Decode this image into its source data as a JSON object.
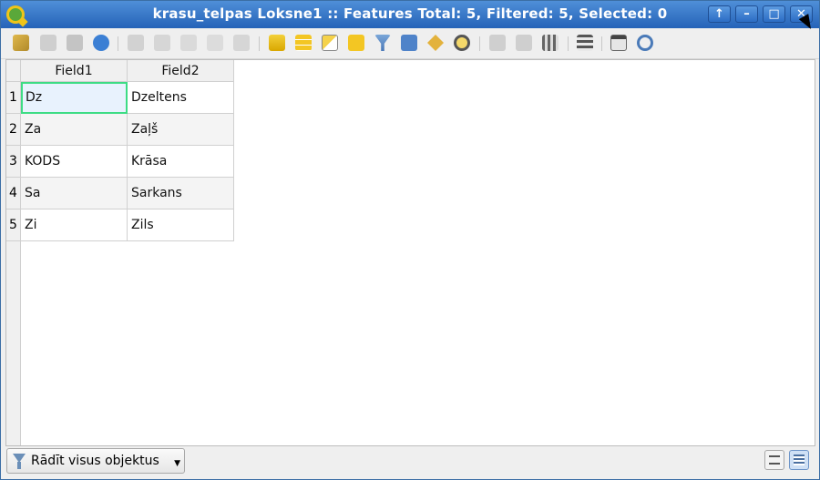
{
  "window": {
    "title": "krasu_telpas Loksne1 :: Features Total: 5, Filtered: 5, Selected: 0",
    "buttons": [
      "up-arrow-icon",
      "minimize-icon",
      "maximize-icon",
      "close-icon"
    ]
  },
  "toolbar": {
    "icons": [
      "toggle-editing-icon",
      "toggle-multi-edit-icon",
      "save-edits-icon",
      "reload-icon",
      "add-feature-icon",
      "delete-feature-icon",
      "cut-icon",
      "copy-icon",
      "paste-icon",
      "select-by-expression-icon",
      "select-all-icon",
      "invert-selection-icon",
      "deselect-all-icon",
      "filter-select-icon",
      "move-selection-to-top-icon",
      "pan-to-selected-icon",
      "zoom-to-selected-icon",
      "new-field-icon",
      "delete-field-icon",
      "field-calculator-icon",
      "conditional-formatting-icon",
      "dock-icon",
      "actions-icon"
    ]
  },
  "table": {
    "columns": [
      "Field1",
      "Field2"
    ],
    "rows": [
      {
        "num": "1",
        "field1": "Dz",
        "field2": "Dzeltens"
      },
      {
        "num": "2",
        "field1": "Za",
        "field2": "Zaļš"
      },
      {
        "num": "3",
        "field1": "KODS",
        "field2": "Krāsa"
      },
      {
        "num": "4",
        "field1": "Sa",
        "field2": "Sarkans"
      },
      {
        "num": "5",
        "field1": "Zi",
        "field2": "Zils"
      }
    ]
  },
  "statusbar": {
    "filter_label": "Rādīt visus objektus",
    "filter_icon": "filter-icon",
    "form_view_icon": "form-view-icon",
    "table_view_icon": "table-view-icon"
  },
  "colors": {
    "titlebar": "#2563b8",
    "selected_cell_border": "#3ddc84",
    "selected_cell_bg": "#e8f2fd"
  }
}
